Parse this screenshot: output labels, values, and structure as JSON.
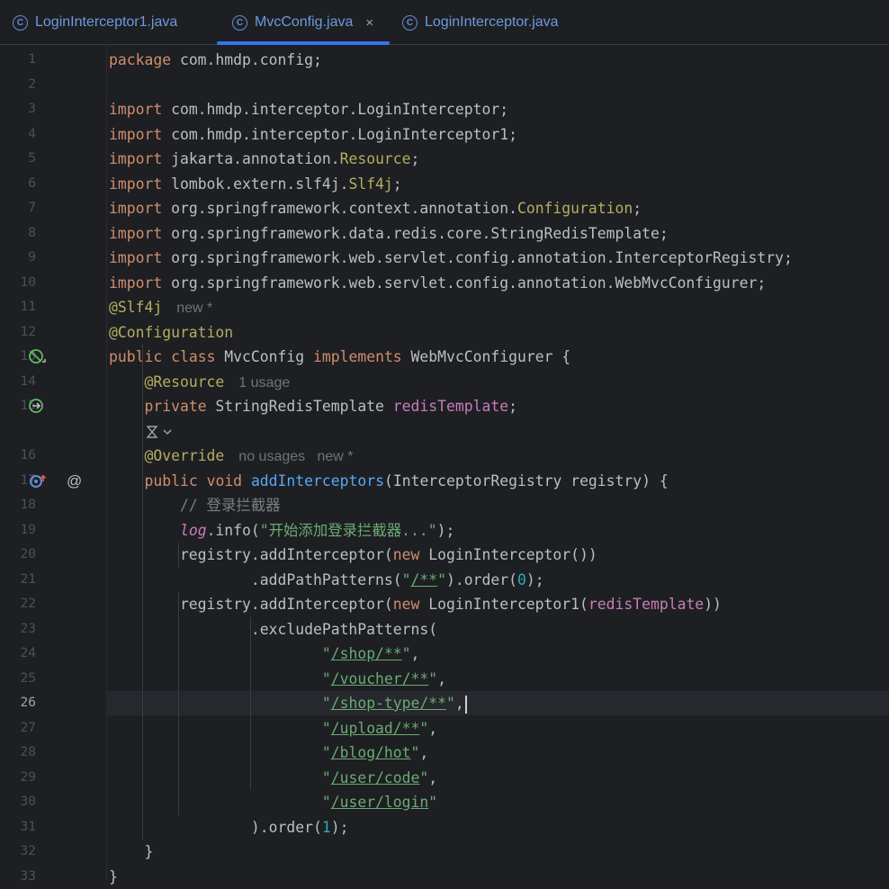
{
  "tabs": [
    {
      "label": "LoginInterceptor1.java",
      "icon": "class-icon",
      "active": false
    },
    {
      "label": "MvcConfig.java",
      "icon": "class-icon",
      "active": true,
      "close": "×"
    },
    {
      "label": "LoginInterceptor.java",
      "icon": "class-icon",
      "active": false
    }
  ],
  "class_icon_glyph": "C",
  "colors": {
    "keyword": "#cf8e6d",
    "annotation": "#b3ae60",
    "string": "#6aab73",
    "field": "#c77dbb",
    "method": "#56a8f5",
    "number": "#2aacb8",
    "comment": "#7a7e85",
    "text": "#bcbec4",
    "hint": "#6f737a",
    "accent": "#3574f0"
  },
  "current_line": 26,
  "lines": [
    {
      "n": "1",
      "s": [
        {
          "t": "package",
          "c": "kw"
        },
        {
          "t": " com.hmdp.config;"
        }
      ]
    },
    {
      "n": "2",
      "s": []
    },
    {
      "n": "3",
      "s": [
        {
          "t": "import",
          "c": "kw"
        },
        {
          "t": " com.hmdp.interceptor.LoginInterceptor;"
        }
      ]
    },
    {
      "n": "4",
      "s": [
        {
          "t": "import",
          "c": "kw"
        },
        {
          "t": " com.hmdp.interceptor.LoginInterceptor1;"
        }
      ]
    },
    {
      "n": "5",
      "s": [
        {
          "t": "import",
          "c": "kw"
        },
        {
          "t": " jakarta.annotation."
        },
        {
          "t": "Resource",
          "c": "an"
        },
        {
          "t": ";"
        }
      ]
    },
    {
      "n": "6",
      "s": [
        {
          "t": "import",
          "c": "kw"
        },
        {
          "t": " lombok.extern.slf4j."
        },
        {
          "t": "Slf4j",
          "c": "an"
        },
        {
          "t": ";"
        }
      ]
    },
    {
      "n": "7",
      "s": [
        {
          "t": "import",
          "c": "kw"
        },
        {
          "t": " org.springframework.context.annotation."
        },
        {
          "t": "Configuration",
          "c": "an"
        },
        {
          "t": ";"
        }
      ]
    },
    {
      "n": "8",
      "s": [
        {
          "t": "import",
          "c": "kw"
        },
        {
          "t": " org.springframework.data.redis.core.StringRedisTemplate;"
        }
      ]
    },
    {
      "n": "9",
      "s": [
        {
          "t": "import",
          "c": "kw"
        },
        {
          "t": " org.springframework.web.servlet.config.annotation.InterceptorRegistry;"
        }
      ]
    },
    {
      "n": "10",
      "s": [
        {
          "t": "import",
          "c": "kw"
        },
        {
          "t": " org.springframework.web.servlet.config.annotation.WebMvcConfigurer;"
        }
      ]
    },
    {
      "n": "11",
      "s": [
        {
          "t": "@Slf4j",
          "c": "an"
        }
      ],
      "hint": "new *"
    },
    {
      "n": "12",
      "s": [
        {
          "t": "@Configuration",
          "c": "an"
        }
      ]
    },
    {
      "n": "13",
      "gutter": "bean-icon",
      "s": [
        {
          "t": "public",
          "c": "kw"
        },
        {
          "t": " "
        },
        {
          "t": "class",
          "c": "kw"
        },
        {
          "t": " MvcConfig "
        },
        {
          "t": "implements",
          "c": "kw"
        },
        {
          "t": " WebMvcConfigurer {"
        }
      ]
    },
    {
      "n": "14",
      "s": [
        {
          "t": "    "
        },
        {
          "t": "@Resource",
          "c": "an"
        }
      ],
      "hint": "1 usage"
    },
    {
      "n": "15",
      "gutter": "injection-icon",
      "s": [
        {
          "t": "    "
        },
        {
          "t": "private",
          "c": "kw"
        },
        {
          "t": " StringRedisTemplate "
        },
        {
          "t": "redisTemplate",
          "c": "fd"
        },
        {
          "t": ";"
        }
      ]
    },
    {
      "n": "",
      "s": [
        {
          "t": "    "
        }
      ],
      "ai": true
    },
    {
      "n": "16",
      "s": [
        {
          "t": "    "
        },
        {
          "t": "@Override",
          "c": "an"
        }
      ],
      "hint": "no usages   new *"
    },
    {
      "n": "17",
      "gutter": "override-icon",
      "s": [
        {
          "t": "    "
        },
        {
          "t": "public",
          "c": "kw"
        },
        {
          "t": " "
        },
        {
          "t": "void",
          "c": "kw"
        },
        {
          "t": " "
        },
        {
          "t": "addInterceptors",
          "c": "mt"
        },
        {
          "t": "(InterceptorRegistry registry) {"
        }
      ]
    },
    {
      "n": "18",
      "s": [
        {
          "t": "        "
        },
        {
          "t": "// 登录拦截器",
          "c": "cm"
        }
      ]
    },
    {
      "n": "19",
      "s": [
        {
          "t": "        "
        },
        {
          "t": "log",
          "c": "fdi"
        },
        {
          "t": ".info("
        },
        {
          "t": "\"开始添加登录拦截器...\"",
          "c": "st"
        },
        {
          "t": ");"
        }
      ]
    },
    {
      "n": "20",
      "s": [
        {
          "t": "        registry.addInterceptor("
        },
        {
          "t": "new",
          "c": "kw"
        },
        {
          "t": " LoginInterceptor())"
        }
      ]
    },
    {
      "n": "21",
      "s": [
        {
          "t": "                .addPathPatterns("
        },
        {
          "t": "\"",
          "c": "st"
        },
        {
          "t": "/**",
          "c": "stu"
        },
        {
          "t": "\"",
          "c": "st"
        },
        {
          "t": ").order("
        },
        {
          "t": "0",
          "c": "nm"
        },
        {
          "t": ");"
        }
      ]
    },
    {
      "n": "22",
      "s": [
        {
          "t": "        registry.addInterceptor("
        },
        {
          "t": "new",
          "c": "kw"
        },
        {
          "t": " LoginInterceptor1("
        },
        {
          "t": "redisTemplate",
          "c": "fd"
        },
        {
          "t": "))"
        }
      ]
    },
    {
      "n": "23",
      "s": [
        {
          "t": "                .excludePathPatterns("
        }
      ]
    },
    {
      "n": "24",
      "s": [
        {
          "t": "                        "
        },
        {
          "t": "\"",
          "c": "st"
        },
        {
          "t": "/shop/**",
          "c": "stu"
        },
        {
          "t": "\"",
          "c": "st"
        },
        {
          "t": ","
        }
      ]
    },
    {
      "n": "25",
      "s": [
        {
          "t": "                        "
        },
        {
          "t": "\"",
          "c": "st"
        },
        {
          "t": "/voucher/**",
          "c": "stu"
        },
        {
          "t": "\"",
          "c": "st"
        },
        {
          "t": ","
        }
      ]
    },
    {
      "n": "26",
      "s": [
        {
          "t": "                        "
        },
        {
          "t": "\"",
          "c": "st"
        },
        {
          "t": "/shop-type/**",
          "c": "stu"
        },
        {
          "t": "\"",
          "c": "st"
        },
        {
          "t": ","
        }
      ],
      "cursor": true
    },
    {
      "n": "27",
      "s": [
        {
          "t": "                        "
        },
        {
          "t": "\"",
          "c": "st"
        },
        {
          "t": "/upload/**",
          "c": "stu"
        },
        {
          "t": "\"",
          "c": "st"
        },
        {
          "t": ","
        }
      ]
    },
    {
      "n": "28",
      "s": [
        {
          "t": "                        "
        },
        {
          "t": "\"",
          "c": "st"
        },
        {
          "t": "/blog/hot",
          "c": "stu"
        },
        {
          "t": "\"",
          "c": "st"
        },
        {
          "t": ","
        }
      ]
    },
    {
      "n": "29",
      "s": [
        {
          "t": "                        "
        },
        {
          "t": "\"",
          "c": "st"
        },
        {
          "t": "/user/code",
          "c": "stu"
        },
        {
          "t": "\"",
          "c": "st"
        },
        {
          "t": ","
        }
      ]
    },
    {
      "n": "30",
      "s": [
        {
          "t": "                        "
        },
        {
          "t": "\"",
          "c": "st"
        },
        {
          "t": "/user/login",
          "c": "stu"
        },
        {
          "t": "\"",
          "c": "st"
        }
      ]
    },
    {
      "n": "31",
      "s": [
        {
          "t": "                ).order("
        },
        {
          "t": "1",
          "c": "nm"
        },
        {
          "t": ");"
        }
      ]
    },
    {
      "n": "32",
      "s": [
        {
          "t": "    }"
        }
      ]
    },
    {
      "n": "33",
      "s": [
        {
          "t": "}"
        }
      ]
    }
  ]
}
